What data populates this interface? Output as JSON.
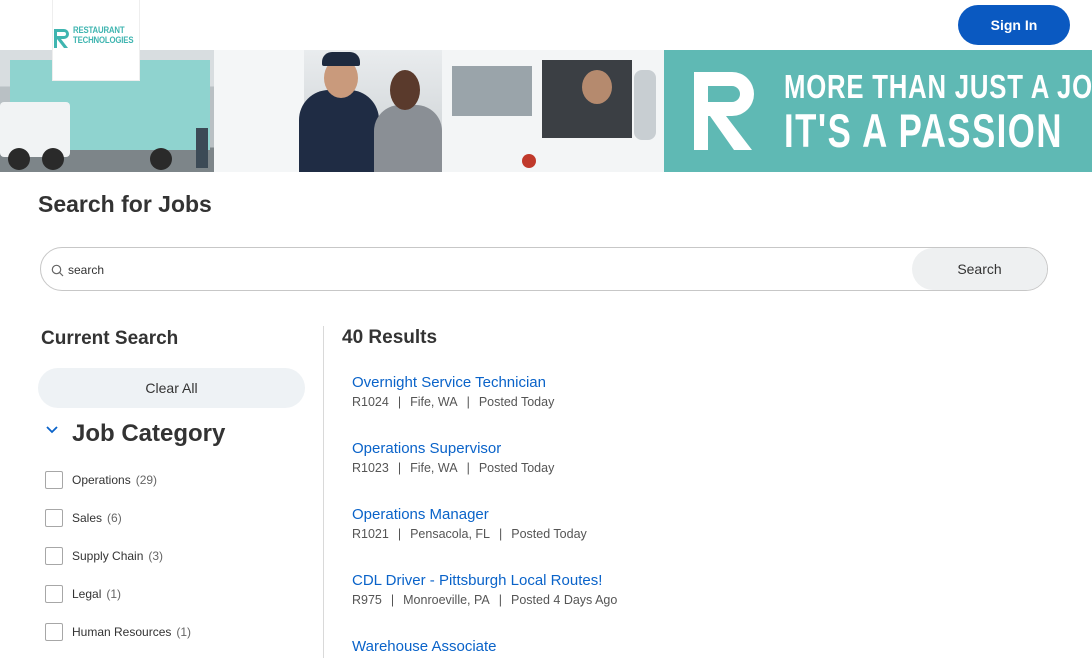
{
  "header": {
    "logo_text_line1": "RESTAURANT",
    "logo_text_line2": "TECHNOLOGIES",
    "signin_label": "Sign In",
    "brand_color": "#3fb5b0",
    "signin_color": "#0a59c1"
  },
  "banner": {
    "slogan_line1": "MORE THAN JUST A JOB",
    "slogan_line2": "IT'S A PASSION",
    "panel_color": "#5fb9b4"
  },
  "search": {
    "title": "Search for Jobs",
    "placeholder": "search",
    "button_label": "Search",
    "icon": "search-icon"
  },
  "filters": {
    "heading": "Current Search",
    "clear_all_label": "Clear All",
    "category_title": "Job Category",
    "category_icon": "chevron-down-icon",
    "items": [
      {
        "label": "Operations",
        "count": "(29)"
      },
      {
        "label": "Sales",
        "count": "(6)"
      },
      {
        "label": "Supply Chain",
        "count": "(3)"
      },
      {
        "label": "Legal",
        "count": "(1)"
      },
      {
        "label": "Human Resources",
        "count": "(1)"
      }
    ]
  },
  "results": {
    "count_label": "40 Results",
    "link_color": "#0a63c9",
    "jobs": [
      {
        "title": "Overnight Service Technician",
        "id": "R1024",
        "location": "Fife, WA",
        "posted": "Posted Today"
      },
      {
        "title": "Operations Supervisor",
        "id": "R1023",
        "location": "Fife, WA",
        "posted": "Posted Today"
      },
      {
        "title": "Operations Manager",
        "id": "R1021",
        "location": "Pensacola, FL",
        "posted": "Posted Today"
      },
      {
        "title": "CDL Driver - Pittsburgh Local Routes!",
        "id": "R975",
        "location": "Monroeville, PA",
        "posted": "Posted 4 Days Ago"
      },
      {
        "title": "Warehouse Associate",
        "id": "",
        "location": "",
        "posted": ""
      }
    ],
    "separator": "|"
  }
}
